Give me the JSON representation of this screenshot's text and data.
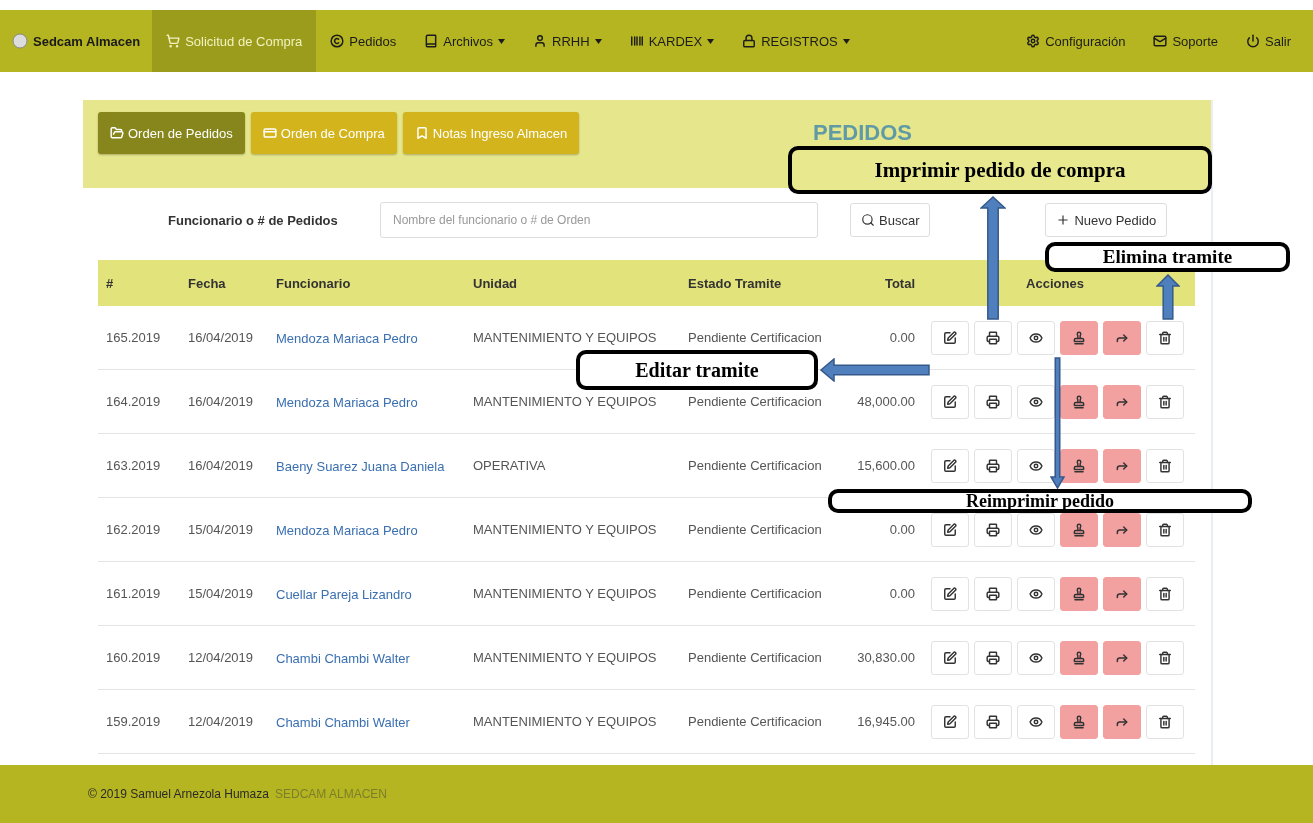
{
  "navbar": {
    "brand": "Sedcam Almacen",
    "items": [
      {
        "label": "Solicitud de Compra",
        "kind": "cart",
        "selected": true,
        "dropdown": false
      },
      {
        "label": "Pedidos",
        "kind": "orders",
        "selected": false,
        "dropdown": false
      },
      {
        "label": "Archivos",
        "kind": "files",
        "selected": false,
        "dropdown": true
      },
      {
        "label": "RRHH",
        "kind": "staff",
        "selected": false,
        "dropdown": true
      },
      {
        "label": "KARDEX",
        "kind": "kardex",
        "selected": false,
        "dropdown": true
      },
      {
        "label": "REGISTROS",
        "kind": "records",
        "selected": false,
        "dropdown": true
      }
    ],
    "right_items": [
      {
        "label": "Configuración",
        "kind": "settings"
      },
      {
        "label": "Soporte",
        "kind": "support"
      },
      {
        "label": "Salir",
        "kind": "logout"
      }
    ]
  },
  "tabs": [
    {
      "label": "Orden de Pedidos",
      "kind": "orders",
      "selected": true
    },
    {
      "label": "Orden de Compra",
      "kind": "purchase",
      "selected": false
    },
    {
      "label": "Notas Ingreso Almacen",
      "kind": "notes",
      "selected": false
    }
  ],
  "page_title": "PEDIDOS",
  "search": {
    "label": "Funcionario o # de Pedidos",
    "placeholder": "Nombre del funcionario o # de Orden",
    "button": "Buscar"
  },
  "new_button": "Nuevo Pedido",
  "table": {
    "columns": [
      "#",
      "Fecha",
      "Funcionario",
      "Unidad",
      "Estado Tramite",
      "Total",
      "Acciones"
    ],
    "row_actions": [
      {
        "kind": "edit"
      },
      {
        "kind": "print"
      },
      {
        "kind": "view"
      },
      {
        "kind": "approve"
      },
      {
        "kind": "forward"
      },
      {
        "kind": "delete"
      }
    ],
    "rows": [
      {
        "number": "165.2019",
        "date": "16/04/2019",
        "employee": "Mendoza Mariaca Pedro",
        "unit": "MANTENIMIENTO Y EQUIPOS",
        "status": "Pendiente Certificacion",
        "total": "0.00"
      },
      {
        "number": "164.2019",
        "date": "16/04/2019",
        "employee": "Mendoza Mariaca Pedro",
        "unit": "MANTENIMIENTO Y EQUIPOS",
        "status": "Pendiente Certificacion",
        "total": "48,000.00"
      },
      {
        "number": "163.2019",
        "date": "16/04/2019",
        "employee": "Baeny Suarez Juana Daniela",
        "unit": "OPERATIVA",
        "status": "Pendiente Certificacion",
        "total": "15,600.00"
      },
      {
        "number": "162.2019",
        "date": "15/04/2019",
        "employee": "Mendoza Mariaca Pedro",
        "unit": "MANTENIMIENTO Y EQUIPOS",
        "status": "Pendiente Certificacion",
        "total": "0.00"
      },
      {
        "number": "161.2019",
        "date": "15/04/2019",
        "employee": "Cuellar Pareja Lizandro",
        "unit": "MANTENIMIENTO Y EQUIPOS",
        "status": "Pendiente Certificacion",
        "total": "0.00"
      },
      {
        "number": "160.2019",
        "date": "12/04/2019",
        "employee": "Chambi Chambi Walter",
        "unit": "MANTENIMIENTO Y EQUIPOS",
        "status": "Pendiente Certificacion",
        "total": "30,830.00"
      },
      {
        "number": "159.2019",
        "date": "12/04/2019",
        "employee": "Chambi Chambi Walter",
        "unit": "MANTENIMIENTO Y EQUIPOS",
        "status": "Pendiente Certificacion",
        "total": "16,945.00"
      }
    ]
  },
  "annotations": [
    {
      "text": "Imprimir pedido de compra",
      "filled": true
    },
    {
      "text": "Elimina tramite",
      "filled": false
    },
    {
      "text": "Editar tramite",
      "filled": false
    },
    {
      "text": "Reimprimir pedido",
      "filled": false
    }
  ],
  "footer": {
    "copyright": "© 2019",
    "author": "Samuel Arnezola Humaza",
    "brand": "SEDCAM ALMACEN"
  }
}
